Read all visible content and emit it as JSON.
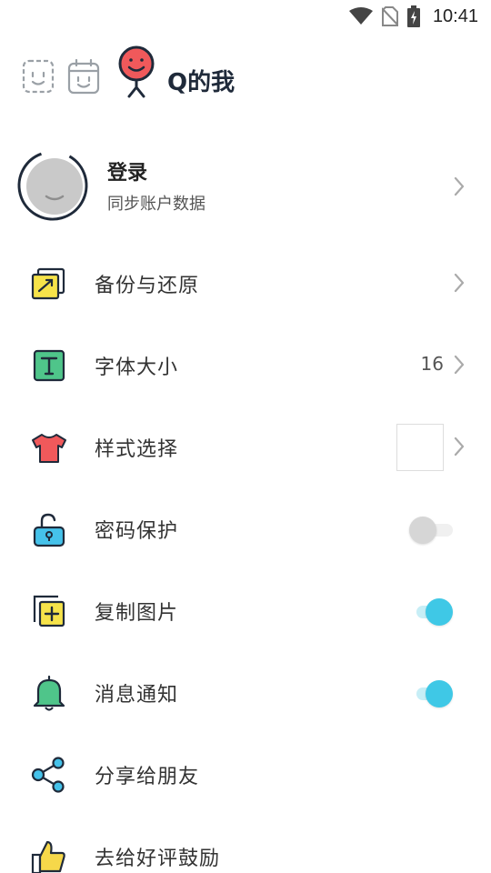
{
  "status_bar": {
    "time": "10:41",
    "icons": [
      "wifi-icon",
      "no-sim-icon",
      "battery-charging-icon"
    ]
  },
  "header": {
    "title": "Q的我",
    "icons": [
      "face-card-icon",
      "calendar-face-icon",
      "character-avatar-icon"
    ]
  },
  "login": {
    "title": "登录",
    "subtitle": "同步账户数据"
  },
  "settings": [
    {
      "label": "备份与还原",
      "icon": "backup-restore-icon",
      "control": "chevron"
    },
    {
      "label": "字体大小",
      "icon": "font-size-icon",
      "control": "value-chevron",
      "value": "16"
    },
    {
      "label": "样式选择",
      "icon": "tshirt-icon",
      "control": "swatch-chevron"
    },
    {
      "label": "密码保护",
      "icon": "lock-icon",
      "control": "toggle",
      "enabled": false
    },
    {
      "label": "复制图片",
      "icon": "copy-add-icon",
      "control": "toggle",
      "enabled": true
    },
    {
      "label": "消息通知",
      "icon": "bell-icon",
      "control": "toggle",
      "enabled": true
    },
    {
      "label": "分享给朋友",
      "icon": "share-icon",
      "control": "none"
    },
    {
      "label": "去给好评鼓励",
      "icon": "thumbs-up-icon",
      "control": "none"
    }
  ],
  "colors": {
    "accent": "#3fc8e6",
    "title": "#1f2a3a",
    "avatar_face": "#f0595b"
  }
}
